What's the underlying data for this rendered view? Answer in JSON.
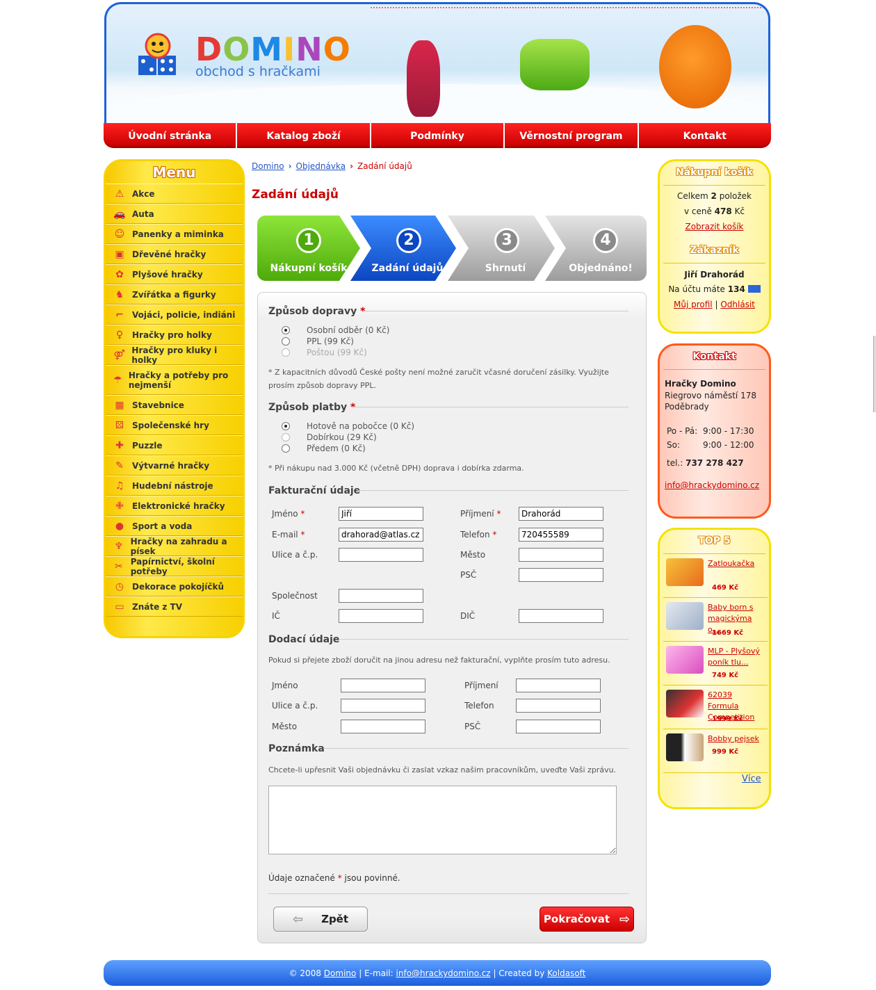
{
  "header": {
    "logo_title": "DOMINO",
    "logo_subtitle": "obchod s hračkami",
    "logo_colors": [
      "#e53935",
      "#1e88e5",
      "#fbc02d",
      "#8bc34a",
      "#ab47bc",
      "#f57c00"
    ]
  },
  "nav": [
    {
      "label": "Úvodní stránka"
    },
    {
      "label": "Katalog zboží"
    },
    {
      "label": "Podmínky"
    },
    {
      "label": "Věrnostní program"
    },
    {
      "label": "Kontakt"
    }
  ],
  "menu": {
    "title": "Menu",
    "items": [
      {
        "label": "Akce",
        "icon": "warning-icon"
      },
      {
        "label": "Auta",
        "icon": "car-icon"
      },
      {
        "label": "Panenky a miminka",
        "icon": "baby-icon"
      },
      {
        "label": "Dřevěné hračky",
        "icon": "train-icon"
      },
      {
        "label": "Plyšové hračky",
        "icon": "teddy-icon"
      },
      {
        "label": "Zvířátka a figurky",
        "icon": "horse-icon"
      },
      {
        "label": "Vojáci, policie, indiáni",
        "icon": "gun-icon"
      },
      {
        "label": "Hračky pro holky",
        "icon": "girl-icon"
      },
      {
        "label": "Hračky pro kluky i holky",
        "icon": "kids-icon"
      },
      {
        "label": "Hračky a potřeby pro nejmenší",
        "icon": "rattle-icon"
      },
      {
        "label": "Stavebnice",
        "icon": "bricks-icon"
      },
      {
        "label": "Společenské hry",
        "icon": "dice-icon"
      },
      {
        "label": "Puzzle",
        "icon": "puzzle-icon"
      },
      {
        "label": "Výtvarné hračky",
        "icon": "palette-icon"
      },
      {
        "label": "Hudební nástroje",
        "icon": "music-icon"
      },
      {
        "label": "Elektronické hračky",
        "icon": "plus-icon"
      },
      {
        "label": "Sport a voda",
        "icon": "ball-icon"
      },
      {
        "label": "Hračky na zahradu a písek",
        "icon": "bucket-icon"
      },
      {
        "label": "Papírnictví, školní potřeby",
        "icon": "scissors-icon"
      },
      {
        "label": "Dekorace pokojíčků",
        "icon": "clock-icon"
      },
      {
        "label": "Znáte z TV",
        "icon": "tv-icon"
      }
    ]
  },
  "breadcrumb": {
    "home": "Domino",
    "order": "Objednávka",
    "current": "Zadání údajů"
  },
  "page_title": "Zadání údajů",
  "steps": [
    {
      "num": "1",
      "label": "Nákupní košík",
      "color": "#5cbd10"
    },
    {
      "num": "2",
      "label": "Zadání údajů",
      "color": "#1a63e0"
    },
    {
      "num": "3",
      "label": "Shrnutí",
      "color": "#a8a8a8"
    },
    {
      "num": "4",
      "label": "Objednáno!",
      "color": "#a8a8a8"
    }
  ],
  "shipping": {
    "title": "Způsob dopravy",
    "req": "*",
    "options": [
      "Osobní odběr (0 Kč)",
      "PPL (99 Kč)",
      "Poštou (99 Kč)"
    ],
    "note": "* Z kapacitních důvodů České pošty není možné zaručit včasné doručení zásilky. Využijte prosím způsob dopravy PPL."
  },
  "payment": {
    "title": "Způsob platby",
    "req": "*",
    "options": [
      "Hotově na pobočce (0 Kč)",
      "Dobírkou (29 Kč)",
      "Předem (0 Kč)"
    ],
    "note": "* Při nákupu nad 3.000 Kč (včetně DPH) doprava i dobírka zdarma."
  },
  "billing": {
    "title": "Fakturační údaje",
    "req": "*",
    "jmeno_label": "Jméno",
    "jmeno_value": "Jiří",
    "prijmeni_label": "Příjmení",
    "prijmeni_value": "Drahorád",
    "email_label": "E-mail",
    "email_value": "drahorad@atlas.cz",
    "telefon_label": "Telefon",
    "telefon_value": "720455589",
    "ulice_label": "Ulice a č.p.",
    "mesto_label": "Město",
    "psc_label": "PSČ",
    "spolecnost_label": "Společnost",
    "ic_label": "IČ",
    "dic_label": "DIČ"
  },
  "delivery": {
    "title": "Dodací údaje",
    "note": "Pokud si přejete zboží doručit na jinou adresu než fakturační, vyplňte prosím tuto adresu.",
    "jmeno_label": "Jméno",
    "prijmeni_label": "Příjmení",
    "ulice_label": "Ulice a č.p.",
    "telefon_label": "Telefon",
    "mesto_label": "Město",
    "psc_label": "PSČ"
  },
  "remark": {
    "title": "Poznámka",
    "note": "Chcete-li upřesnit Vaši objednávku či zaslat vzkaz našim pracovníkům, uveďte Vaši zprávu."
  },
  "required_note": {
    "pre": "Údaje označené",
    "star": "*",
    "post": "jsou povinné."
  },
  "buttons": {
    "back": "Zpět",
    "next": "Pokračovat"
  },
  "cart": {
    "title": "Nákupní košík",
    "line1_pre": "Celkem",
    "count": "2",
    "line1_post": "položek",
    "line2_pre": "v ceně",
    "price": "478",
    "currency": "Kč",
    "show_link": "Zobrazit košík"
  },
  "customer": {
    "title": "Zákazník",
    "name": "Jiří Drahorád",
    "points_pre": "Na účtu máte",
    "points": "134",
    "profile_link": "Můj profil",
    "sep": "|",
    "logout_link": "Odhlásit"
  },
  "contact": {
    "title": "Kontakt",
    "company": "Hračky Domino",
    "street": "Riegrovo náměstí 178",
    "city": "Poděbrady",
    "hours1_day": "Po - Pá:",
    "hours1_time": "9:00 - 17:30",
    "hours2_day": "So:",
    "hours2_time": "9:00 - 12:00",
    "tel_label": "tel.:",
    "tel": "737 278 427",
    "email": "info@hrackydomino.cz"
  },
  "top5": {
    "title": "TOP 5",
    "items": [
      {
        "name": "Zatloukačka",
        "price": "469 Kč",
        "thumb": "#f29b1d"
      },
      {
        "name": "Baby born s magickýma o...",
        "price": "1669 Kč",
        "thumb": "#cfd8e6"
      },
      {
        "name": "MLP - Plyšový poník tlu...",
        "price": "749 Kč",
        "thumb": "#f27fd0"
      },
      {
        "name": "62039 Formula Competition",
        "price": "1999 Kč",
        "thumb": "#c0392b"
      },
      {
        "name": "Bobby pejsek",
        "price": "999 Kč",
        "thumb": "#b8a07a"
      }
    ],
    "more": "Více"
  },
  "footer": {
    "copy": "© 2008",
    "domino": "Domino",
    "email_label": "| E-mail:",
    "email": "info@hrackydomino.cz",
    "created": "| Created by",
    "koldasoft": "Koldasoft"
  }
}
